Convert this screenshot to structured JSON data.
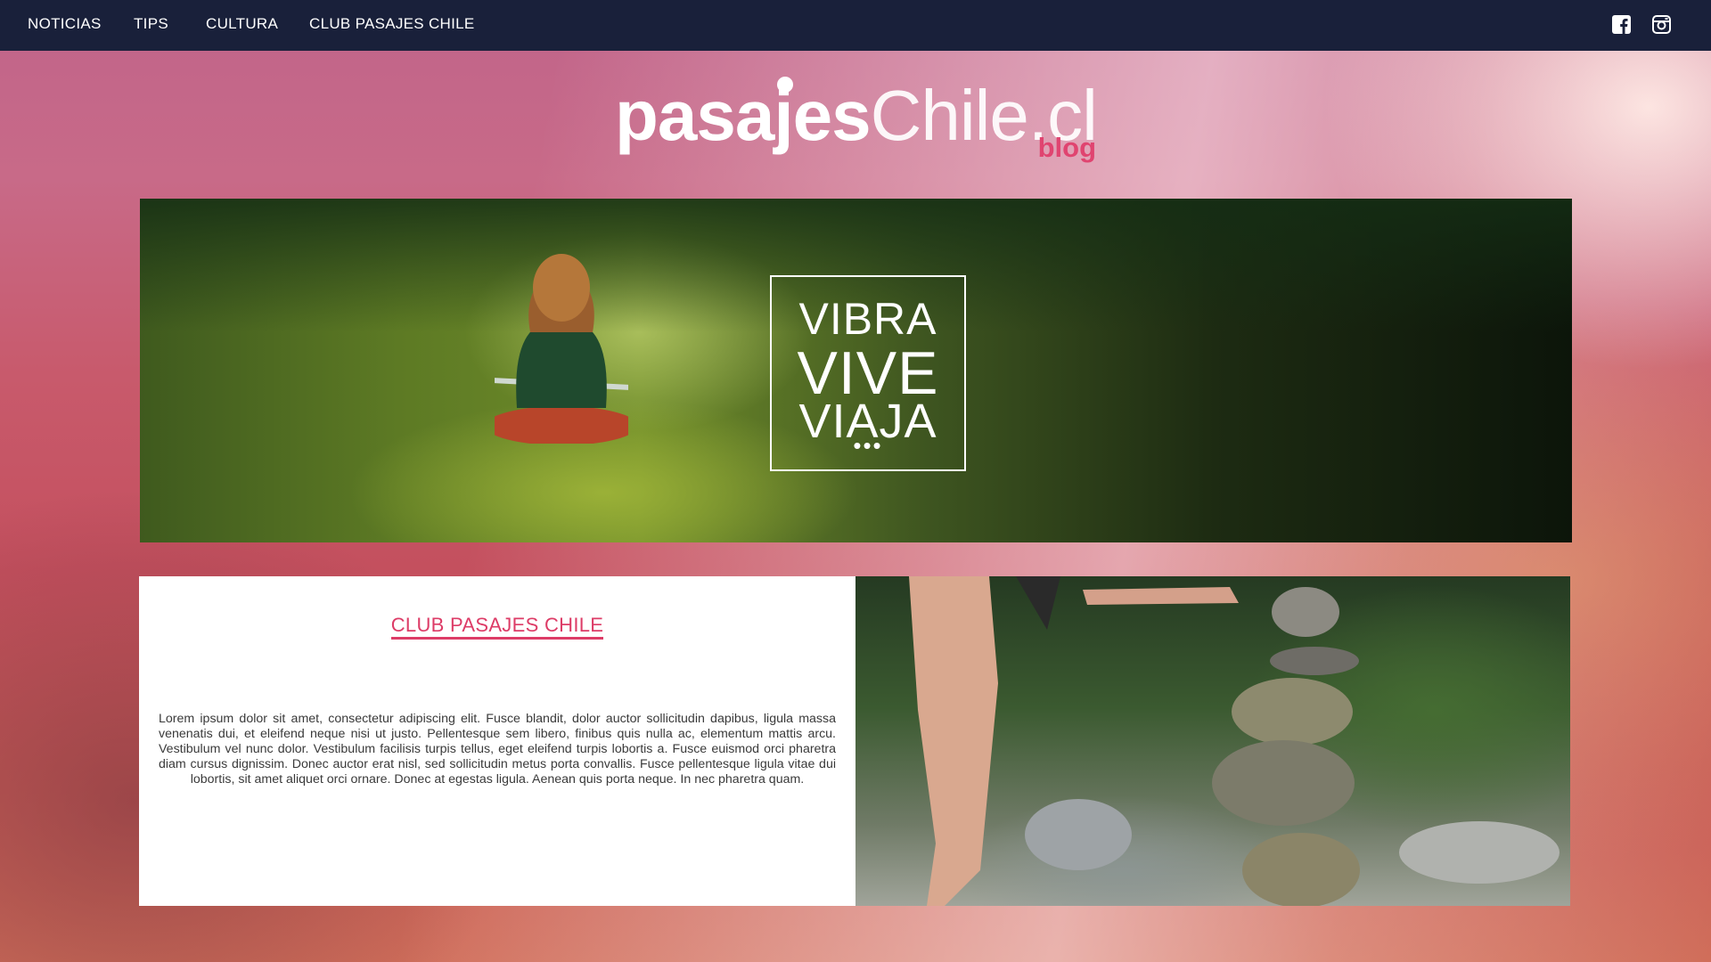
{
  "nav": {
    "items": [
      "NOTICIAS",
      "TIPS",
      "CULTURA",
      "CLUB PASAJES CHILE"
    ],
    "social": [
      "facebook-icon",
      "instagram-icon"
    ]
  },
  "logo": {
    "bold": "pasajes",
    "light": "Chile.cl",
    "sub": "blog"
  },
  "hero": {
    "line1": "VIBRA",
    "line2": "VIVE",
    "line3": "VIAJA",
    "dots": "•••"
  },
  "card": {
    "title": "CLUB PASAJES CHILE",
    "text": "Lorem ipsum dolor sit amet, consectetur adipiscing elit. Fusce blandit, dolor auctor sollicitudin dapibus, ligula massa venenatis dui, et eleifend neque nisi ut justo. Pellentesque sem libero, finibus quis nulla ac, elementum mattis arcu. Vestibulum vel nunc dolor. Vestibulum facilisis turpis tellus, eget eleifend turpis lobortis a. Fusce euismod orci pharetra diam cursus dignissim. Donec auctor erat nisl, sed sollicitudin metus porta convallis. Fusce pellentesque ligula vitae dui lobortis, sit amet aliquet orci ornare. Donec at egestas ligula. Aenean quis porta neque. In nec pharetra quam."
  },
  "colors": {
    "nav_bg": "#19203a",
    "accent": "#dd3c67"
  }
}
